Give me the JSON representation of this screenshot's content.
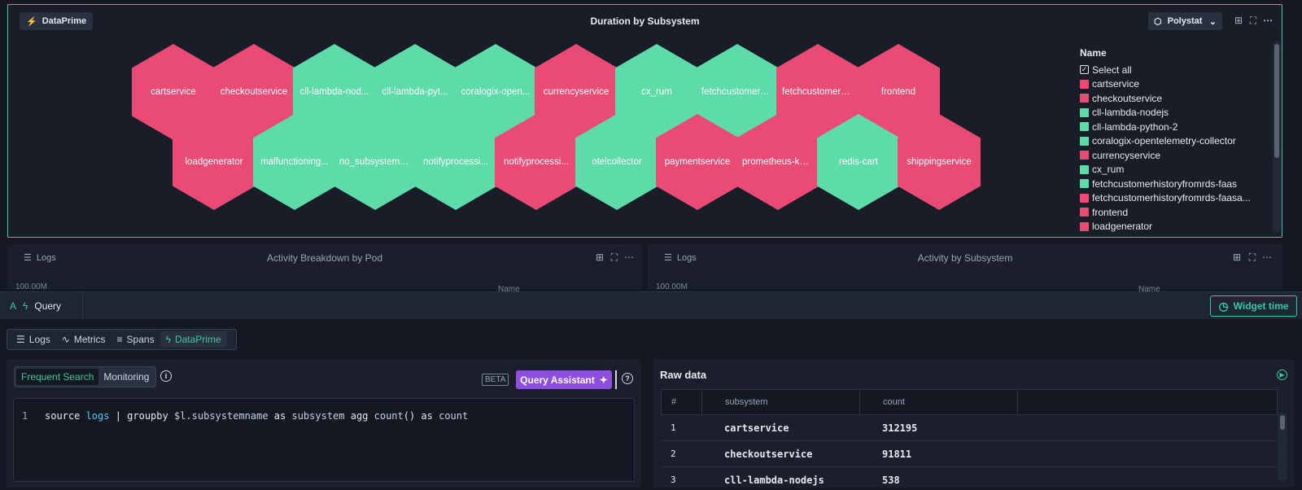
{
  "widget": {
    "badge": "DataPrime",
    "title": "Duration by Subsystem",
    "viz_type": "Polystat",
    "colors": {
      "critical": "#ea4b75",
      "ok": "#5ddba8"
    },
    "hexes": [
      {
        "label": "cartservice",
        "status": "critical"
      },
      {
        "label": "checkoutservice",
        "status": "critical"
      },
      {
        "label": "cll-lambda-nod...",
        "status": "ok"
      },
      {
        "label": "cll-lambda-pyt...",
        "status": "ok"
      },
      {
        "label": "coralogix-open...",
        "status": "ok"
      },
      {
        "label": "currencyservice",
        "status": "critical"
      },
      {
        "label": "cx_rum",
        "status": "ok"
      },
      {
        "label": "fetchcustomerh...",
        "status": "ok"
      },
      {
        "label": "fetchcustomerh...",
        "status": "critical"
      },
      {
        "label": "frontend",
        "status": "critical"
      },
      {
        "label": "loadgenerator",
        "status": "critical"
      },
      {
        "label": "malfunctioning...",
        "status": "ok"
      },
      {
        "label": "no_subsystem_n...",
        "status": "ok"
      },
      {
        "label": "notifyprocessi...",
        "status": "ok"
      },
      {
        "label": "notifyprocessi...",
        "status": "critical"
      },
      {
        "label": "otelcollector",
        "status": "ok"
      },
      {
        "label": "paymentservice",
        "status": "critical"
      },
      {
        "label": "prometheus-kub...",
        "status": "critical"
      },
      {
        "label": "redis-cart",
        "status": "ok"
      },
      {
        "label": "shippingservice",
        "status": "critical"
      }
    ],
    "legend": {
      "header": "Name",
      "select_all": "Select all",
      "items": [
        {
          "label": "cartservice",
          "status": "critical"
        },
        {
          "label": "checkoutservice",
          "status": "critical"
        },
        {
          "label": "cll-lambda-nodejs",
          "status": "ok"
        },
        {
          "label": "cll-lambda-python-2",
          "status": "ok"
        },
        {
          "label": "coralogix-opentelemetry-collector",
          "status": "ok"
        },
        {
          "label": "currencyservice",
          "status": "critical"
        },
        {
          "label": "cx_rum",
          "status": "ok"
        },
        {
          "label": "fetchcustomerhistoryfromrds-faas",
          "status": "ok"
        },
        {
          "label": "fetchcustomerhistoryfromrds-faasa...",
          "status": "critical"
        },
        {
          "label": "frontend",
          "status": "critical"
        },
        {
          "label": "loadgenerator",
          "status": "critical"
        }
      ]
    }
  },
  "panels": [
    {
      "source": "Logs",
      "title": "Activity Breakdown by Pod",
      "y_tick": "100.00M",
      "legend_header": "Name"
    },
    {
      "source": "Logs",
      "title": "Activity by Subsystem",
      "y_tick": "100.00M",
      "legend_header": "Name"
    }
  ],
  "query_bar": {
    "tab_label": "Query",
    "widget_time": "Widget time"
  },
  "query_types": [
    {
      "label": "Logs",
      "icon": "list-icon"
    },
    {
      "label": "Metrics",
      "icon": "pulse-icon"
    },
    {
      "label": "Spans",
      "icon": "bars-icon"
    },
    {
      "label": "DataPrime",
      "icon": "bolt-icon"
    }
  ],
  "editor": {
    "modes": [
      "Frequent Search",
      "Monitoring"
    ],
    "beta": "BETA",
    "assistant": "Query Assistant",
    "line_number": "1",
    "query": [
      {
        "t": "source ",
        "c": "kw"
      },
      {
        "t": "logs",
        "c": "kb"
      },
      {
        "t": " | groupby ",
        "c": "kw"
      },
      {
        "t": "$l.subsystemname",
        "c": "kv"
      },
      {
        "t": " as ",
        "c": "kw"
      },
      {
        "t": "subsystem",
        "c": "kv"
      },
      {
        "t": " agg ",
        "c": "kw"
      },
      {
        "t": "count",
        "c": "kv"
      },
      {
        "t": "()",
        "c": "kw"
      },
      {
        "t": " as ",
        "c": "kw"
      },
      {
        "t": "count",
        "c": "kv"
      }
    ]
  },
  "raw_data": {
    "title": "Raw data",
    "columns": [
      "#",
      "subsystem",
      "count"
    ],
    "rows": [
      {
        "i": "1",
        "subsystem": "cartservice",
        "count": "312195"
      },
      {
        "i": "2",
        "subsystem": "checkoutservice",
        "count": "91811"
      },
      {
        "i": "3",
        "subsystem": "cll-lambda-nodejs",
        "count": "538"
      }
    ]
  }
}
